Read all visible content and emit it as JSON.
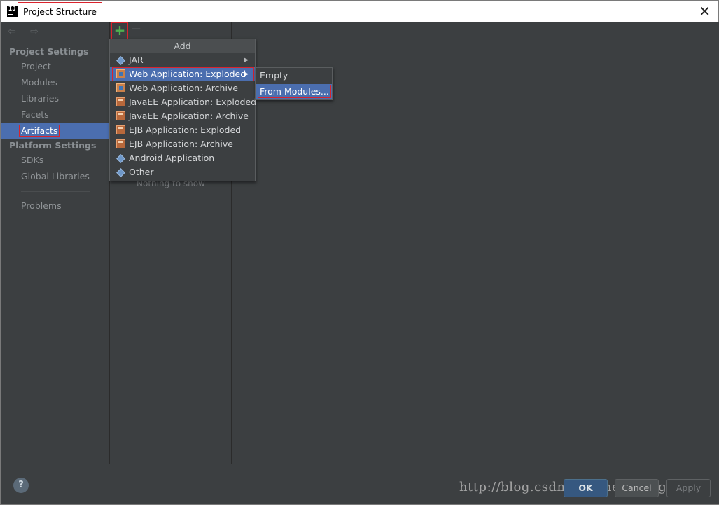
{
  "window": {
    "title": "Project Structure",
    "app_icon_text": "IJ",
    "close_glyph": "✕"
  },
  "toolbar": {
    "back_forward": "⇦ ⇨",
    "add_glyph": "+",
    "remove_glyph": "−"
  },
  "sidebar": {
    "project_settings_heading": "Project Settings",
    "project_items": [
      "Project",
      "Modules",
      "Libraries",
      "Facets",
      "Artifacts"
    ],
    "selected_item": "Artifacts",
    "platform_settings_heading": "Platform Settings",
    "platform_items": [
      "SDKs",
      "Global Libraries"
    ],
    "problems": "Problems"
  },
  "middle": {
    "empty_text": "Nothing to show"
  },
  "add_menu": {
    "header": "Add",
    "items": [
      {
        "label": "JAR",
        "icon": "jar-diamond-icon",
        "submenu": true
      },
      {
        "label": "Web Application: Exploded",
        "icon": "web-app-icon",
        "submenu": true,
        "active": true
      },
      {
        "label": "Web Application: Archive",
        "icon": "web-app-icon"
      },
      {
        "label": "JavaEE Application: Exploded",
        "icon": "javaee-app-icon"
      },
      {
        "label": "JavaEE Application: Archive",
        "icon": "javaee-app-icon"
      },
      {
        "label": "EJB Application: Exploded",
        "icon": "ejb-app-icon"
      },
      {
        "label": "EJB Application: Archive",
        "icon": "ejb-app-icon"
      },
      {
        "label": "Android Application",
        "icon": "android-diamond-icon"
      },
      {
        "label": "Other",
        "icon": "other-diamond-icon"
      }
    ],
    "submenu_arrow": "▶"
  },
  "submenu": {
    "items": [
      "Empty",
      "From Modules..."
    ],
    "active_item": "From Modules..."
  },
  "footer": {
    "help": "?",
    "ok": "OK",
    "cancel": "Cancel",
    "apply": "Apply",
    "watermark": "http://blog.csdn.net/chengtengfei352"
  },
  "colors": {
    "dialog_bg": "#3c3f41",
    "selection": "#4b6eaf",
    "highlight_border": "#d9232d",
    "add_green": "#4fb04f"
  }
}
